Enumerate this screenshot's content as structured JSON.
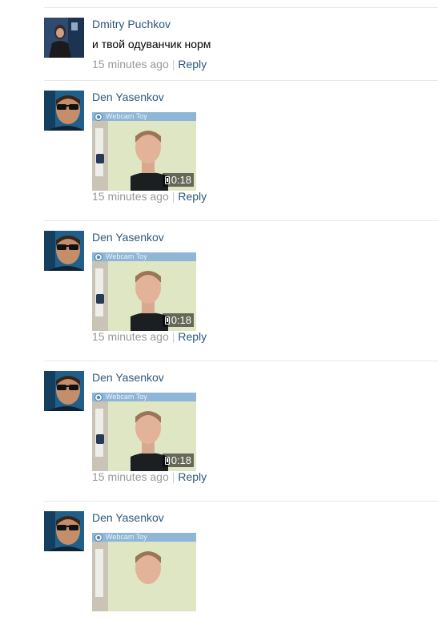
{
  "comments": [
    {
      "author": "Dmitry Puchkov",
      "text": "и твой одуванчик норм",
      "time": "15 minutes ago",
      "separator": "|",
      "reply": "Reply"
    },
    {
      "author": "Den Yasenkov",
      "time": "15 minutes ago",
      "separator": "|",
      "reply": "Reply",
      "video": {
        "duration": "0:18",
        "watermark": "Webcam Toy"
      }
    },
    {
      "author": "Den Yasenkov",
      "time": "15 minutes ago",
      "separator": "|",
      "reply": "Reply",
      "video": {
        "duration": "0:18",
        "watermark": "Webcam Toy"
      }
    },
    {
      "author": "Den Yasenkov",
      "time": "15 minutes ago",
      "separator": "|",
      "reply": "Reply",
      "video": {
        "duration": "0:18",
        "watermark": "Webcam Toy"
      }
    },
    {
      "author": "Den Yasenkov",
      "video": {
        "watermark": "Webcam Toy"
      }
    }
  ],
  "colors": {
    "link": "#2b587a",
    "meta": "#999999",
    "divider": "#e7e8ec"
  },
  "icons": {
    "duration": "phone-icon"
  }
}
